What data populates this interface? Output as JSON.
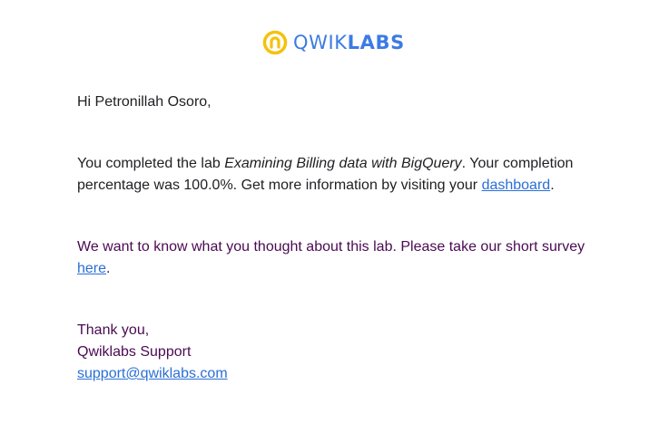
{
  "logo": {
    "brand_light": "QWIK",
    "brand_bold": "LABS",
    "icon": "qwiklabs-logo-icon",
    "color_ring": "#f4c20d",
    "color_text": "#3c7be3"
  },
  "greeting": "Hi Petronillah Osoro,",
  "completion": {
    "text_before": "You completed the lab ",
    "lab_name": "Examining Billing data with BigQuery",
    "text_after": ". Your completion percentage was 100.0%. Get more information by visiting your ",
    "link_label": "dashboard",
    "end": "."
  },
  "survey": {
    "text_before": "We want to know what you thought about this lab. Please take our short survey ",
    "link_label": "here",
    "end": "."
  },
  "signoff": {
    "thanks": "Thank you,",
    "team": "Qwiklabs Support",
    "email": "support@qwiklabs.com"
  },
  "colors": {
    "text": "#202124",
    "purple_text": "#4a0a52",
    "link": "#2a6fd6"
  }
}
